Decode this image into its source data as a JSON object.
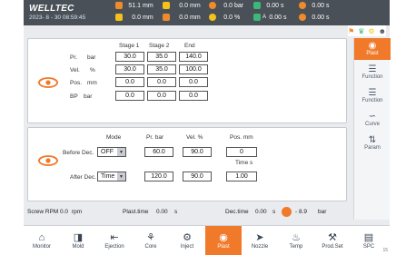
{
  "header": {
    "brand": "WELLTEC",
    "datetime": "2023- 8 - 30 08:59:45",
    "status": [
      {
        "icon": "temperature-icon",
        "value": "51.1",
        "unit": "mm",
        "color": "#f08a2a"
      },
      {
        "icon": "screw-position-icon",
        "value": "0.0",
        "unit": "mm",
        "color": "#f4c21a"
      },
      {
        "icon": "pressure-icon",
        "value": "0.0",
        "unit": "bar",
        "color": "#f08a2a"
      },
      {
        "icon": "cycle-icon",
        "value": "0.00",
        "unit": "s",
        "color": "#3cb878"
      },
      {
        "icon": "timer-icon",
        "value": "0.00",
        "unit": "s",
        "color": "#f08a2a"
      },
      {
        "icon": "mold-position-icon",
        "value": "0.0",
        "unit": "mm",
        "color": "#f4c21a"
      },
      {
        "icon": "ejector-icon",
        "value": "0.0",
        "unit": "mm",
        "color": "#f08a2a"
      },
      {
        "icon": "speed-icon",
        "value": "0.0",
        "unit": "%",
        "color": "#f4c21a"
      },
      {
        "icon": "cycle-a-icon",
        "value": "0.00",
        "unit": "s",
        "color": "#3cb878"
      },
      {
        "icon": "timer-b-icon",
        "value": "0.00",
        "unit": "s",
        "color": "#f08a2a"
      }
    ],
    "cycle_mid_label": "A"
  },
  "holding": {
    "col_headers": [
      "Stage 1",
      "Stage 2",
      "End"
    ],
    "rows": [
      {
        "label": "Pr.",
        "unit": "bar",
        "values": [
          "30.0",
          "35.0",
          "140.0"
        ]
      },
      {
        "label": "Vel.",
        "unit": "%",
        "values": [
          "30.0",
          "35.0",
          "100.0"
        ]
      },
      {
        "label": "Pos.",
        "unit": "mm",
        "values": [
          "0.0",
          "0.0",
          "0.0"
        ]
      },
      {
        "label": "BP",
        "unit": "bar",
        "values": [
          "0.0",
          "0.0",
          "0.0"
        ]
      }
    ]
  },
  "decompress": {
    "headers": {
      "mode": "Mode",
      "pr": "Pr.  bar",
      "vel": "Vel.  %",
      "pos": "Pos.  mm",
      "time": "Time  s"
    },
    "before": {
      "label": "Before Dec.",
      "mode": "OFF",
      "pr": "60.0",
      "vel": "90.0",
      "pos": "0"
    },
    "after": {
      "label": "After Dec.",
      "mode": "Time",
      "pr": "120.0",
      "vel": "90.0",
      "time": "1.00"
    }
  },
  "status_line": {
    "screw_rpm_label": "Screw RPM",
    "screw_rpm_value": "0.0",
    "screw_rpm_unit": "rpm",
    "plast_time_label": "Plast.time",
    "plast_time_value": "0.00",
    "plast_time_unit": "s",
    "dec_time_label": "Dec.time",
    "dec_time_value": "0.00",
    "dec_time_unit": "s",
    "pressure_value": "- 8.9",
    "pressure_unit": "bar"
  },
  "right_tabs": [
    {
      "label": "Plast",
      "icon": "plast-icon",
      "active": true
    },
    {
      "label": "Function",
      "icon": "function-icon"
    },
    {
      "label": "Function",
      "icon": "function-icon"
    },
    {
      "label": "Curve",
      "icon": "curve-icon"
    },
    {
      "label": "Param",
      "icon": "param-icon"
    }
  ],
  "bottom_tabs": [
    {
      "label": "Monitor",
      "icon": "monitor-icon"
    },
    {
      "label": "Mold",
      "icon": "mold-icon"
    },
    {
      "label": "Ejection",
      "icon": "ejection-icon"
    },
    {
      "label": "Core",
      "icon": "core-icon"
    },
    {
      "label": "Inject",
      "icon": "inject-icon"
    },
    {
      "label": "Plast",
      "icon": "plast-icon",
      "active": true
    },
    {
      "label": "Nozzle",
      "icon": "nozzle-icon"
    },
    {
      "label": "Temp",
      "icon": "temp-icon"
    },
    {
      "label": "Prod.Set",
      "icon": "prod-set-icon"
    },
    {
      "label": "SPC",
      "icon": "spc-icon"
    }
  ],
  "page_number": "15",
  "colors": {
    "accent": "#f07a2a",
    "header_bg": "#4a5058"
  }
}
